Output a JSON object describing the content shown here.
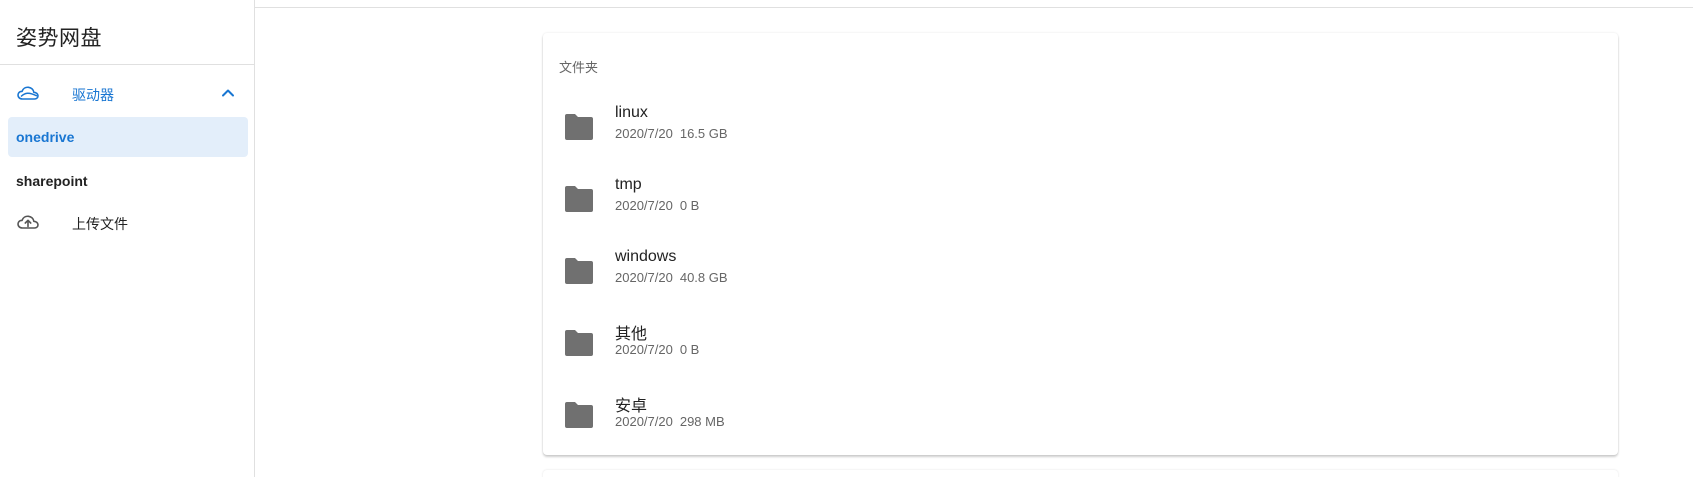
{
  "app": {
    "title": "姿势网盘"
  },
  "sidebar": {
    "group": {
      "label": "驱动器",
      "icon": "cloud-icon",
      "expanded": true
    },
    "items": [
      {
        "label": "onedrive",
        "active": true
      },
      {
        "label": "sharepoint",
        "active": false
      }
    ],
    "upload": {
      "label": "上传文件",
      "icon": "cloud-upload-icon"
    }
  },
  "main": {
    "section_title": "文件夹",
    "folders": [
      {
        "name": "linux",
        "date": "2020/7/20",
        "size": "16.5 GB"
      },
      {
        "name": "tmp",
        "date": "2020/7/20",
        "size": "0 B"
      },
      {
        "name": "windows",
        "date": "2020/7/20",
        "size": "40.8 GB"
      },
      {
        "name": "其他",
        "date": "2020/7/20",
        "size": "0 B"
      },
      {
        "name": "安卓",
        "date": "2020/7/20",
        "size": "298 MB"
      }
    ]
  },
  "colors": {
    "accent": "#1976d2",
    "active_bg": "#e3eefa",
    "folder_icon": "#707070"
  }
}
